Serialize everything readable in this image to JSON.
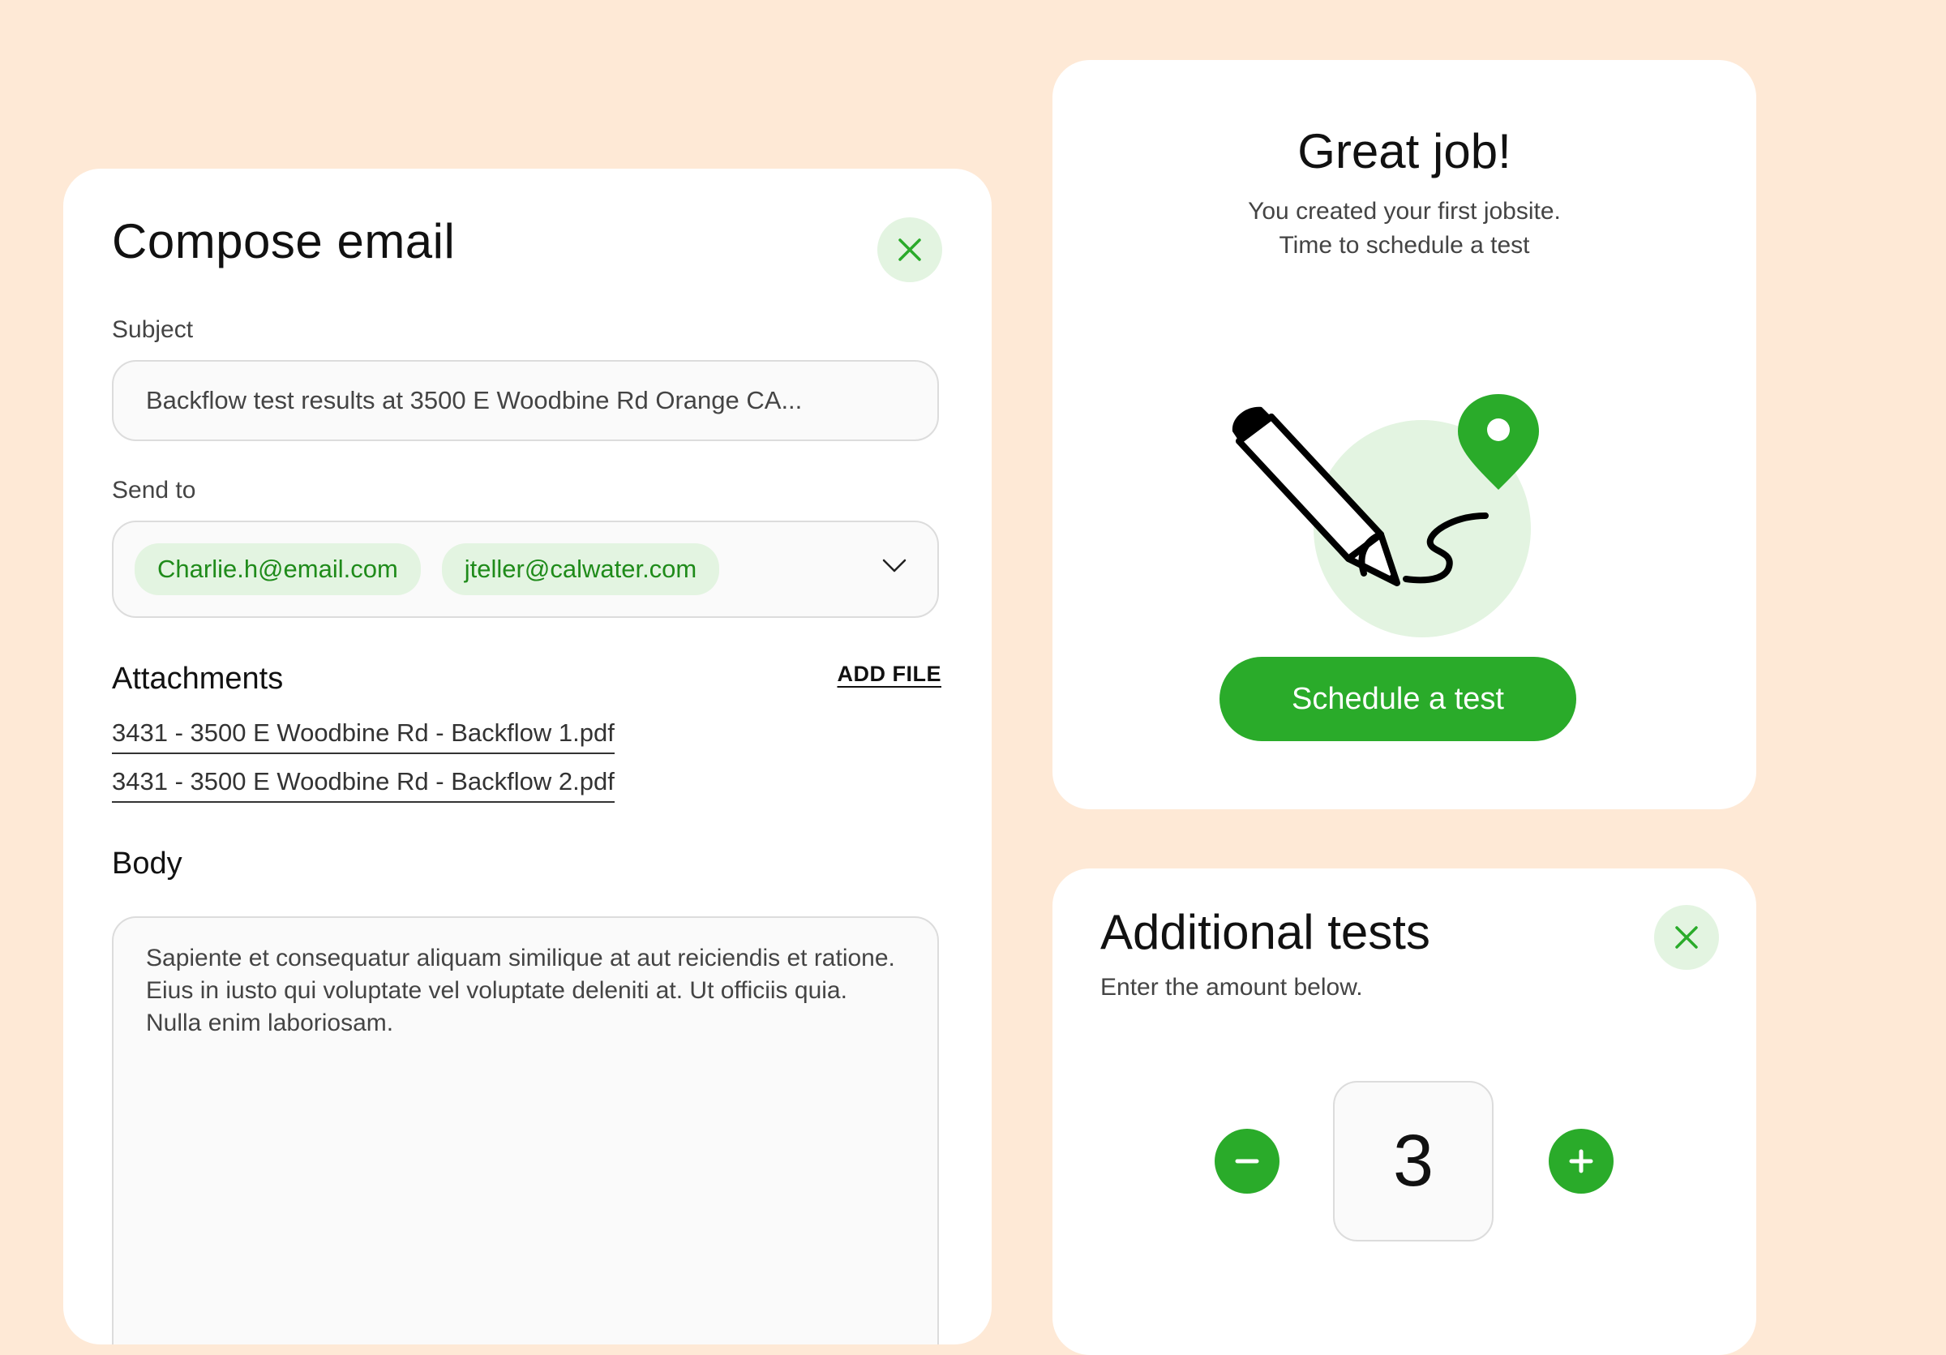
{
  "compose": {
    "title": "Compose email",
    "close_icon": "close-icon",
    "subject_label": "Subject",
    "subject_value": "Backflow test results at 3500 E Woodbine Rd Orange CA...",
    "sendto_label": "Send to",
    "recipients": [
      "Charlie.h@email.com",
      "jteller@calwater.com"
    ],
    "dropdown_icon": "chevron-down-icon",
    "attachments_title": "Attachments",
    "add_file_label": "ADD FILE",
    "attachments": [
      "3431 - 3500 E Woodbine Rd - Backflow 1.pdf",
      "3431 - 3500 E Woodbine Rd - Backflow 2.pdf"
    ],
    "body_title": "Body",
    "body_value": "Sapiente et consequatur aliquam similique at aut reiciendis et ratione. Eius in iusto qui voluptate vel voluptate deleniti at. Ut officiis quia. Nulla enim laboriosam."
  },
  "great_job": {
    "title": "Great job!",
    "subtitle_line1": "You created your first jobsite.",
    "subtitle_line2": "Time to schedule a test",
    "illustration": "pencil-signature-location-pin",
    "button_label": "Schedule a test"
  },
  "additional_tests": {
    "title": "Additional tests",
    "subtitle": "Enter the amount below.",
    "quantity": "3",
    "decrement_icon": "minus-icon",
    "increment_icon": "plus-icon"
  },
  "colors": {
    "background": "#FEE9D6",
    "accent_green": "#2AAB2A",
    "chip_bg": "#E3F4E1",
    "chip_text": "#1F8B1A",
    "light_circle": "#E3F4E1"
  }
}
